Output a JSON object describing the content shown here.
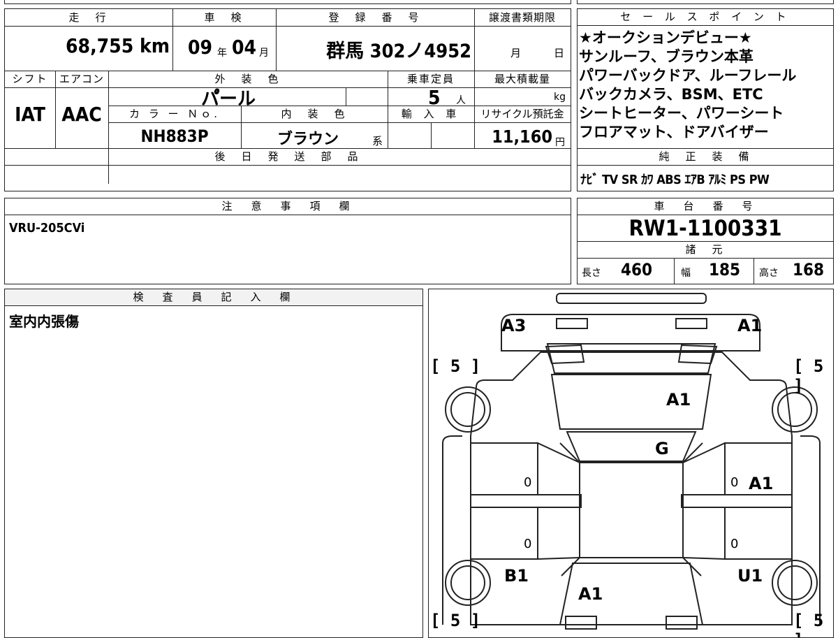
{
  "top_table": {
    "mileage_header": "走　行",
    "mileage_value": "68,755 km",
    "inspection_header": "車　検",
    "inspection_year": "09",
    "inspection_year_unit": "年",
    "inspection_month": "04",
    "inspection_month_unit": "月",
    "registration_header": "登　録　番　号",
    "registration_value": "群馬 302ノ4952",
    "transfer_header": "譲渡書類期限",
    "transfer_month_unit": "月",
    "transfer_day_unit": "日",
    "shift_header": "シフト",
    "shift_value": "IAT",
    "aircon_header": "エアコン",
    "aircon_value": "AAC",
    "exterior_color_header": "外　装　色",
    "exterior_color_value": "パ゚ール",
    "capacity_header": "乗車定員",
    "capacity_value": "5",
    "capacity_unit": "人",
    "max_load_header": "最大積載量",
    "max_load_unit": "kg",
    "color_no_header": "カ ラ ー Ｎｏ.",
    "color_no_value": "NH883P",
    "interior_color_header": "内　装　色",
    "interior_color_value": "ブラウン",
    "interior_color_suffix": "系",
    "import_header": "輸 入 車",
    "recycle_header": "リサイクル預託金",
    "recycle_value": "11,160",
    "recycle_unit": "円",
    "later_parts_header": "後　日　発　送　部　品"
  },
  "sales_points": {
    "header": "セ ー ル ス ポ イ ン ト",
    "lines": [
      "★オークションデビュー★",
      "サンルーフ、ブラウン本革",
      "パワーバックドア、ルーフレール",
      "バックカメラ、BSM、ETC",
      "シートヒーター、パワーシート",
      "フロアマット、ドアバイザー"
    ]
  },
  "standard_equipment": {
    "header": "純　正　装　備",
    "value": "ﾅﾋﾞ TV SR ｶﾜ ABS ｴｱB ｱﾙﾐ PS PW"
  },
  "notes": {
    "header": "注　意　事　項　欄",
    "value": "VRU-205CVi"
  },
  "chassis": {
    "header": "車　台　番　号",
    "value": "RW1-1100331",
    "spec_header": "諸　元",
    "length_label": "長さ",
    "length_value": "460",
    "width_label": "幅",
    "width_value": "185",
    "height_label": "高さ",
    "height_value": "168"
  },
  "inspector": {
    "header": "検　査　員　記　入　欄",
    "value": "室内内張傷"
  },
  "diagram": {
    "marks": {
      "rear_left": "A3",
      "rear_right": "A1",
      "tire_tl": "5",
      "tire_tr": "5",
      "tire_bl": "5",
      "tire_br": "5",
      "rear_glass": "A1",
      "roof": "G",
      "right_rear_door": "A1",
      "front_left": "B1",
      "front_right": "U1",
      "hood": "A1",
      "zero_1": "0",
      "zero_2": "0",
      "zero_3": "0",
      "zero_4": "0"
    }
  }
}
